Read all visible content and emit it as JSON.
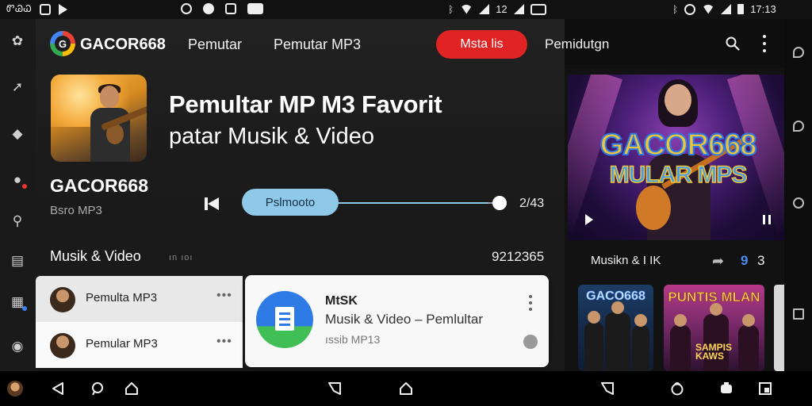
{
  "status_bar": {
    "left_text": "ᏛᏊᏇ",
    "right_time": "17:13",
    "mid_time": "12"
  },
  "header": {
    "brand": "GACOR668",
    "logo_letter": "G",
    "nav": [
      "Pemutar",
      "Pemutar MP3"
    ],
    "pill_label": "Msta lis",
    "nav_right": "Pemidutgn"
  },
  "now_playing": {
    "title": "Pemultar MP M3 Favorit",
    "subtitle": "patar Musik & Video",
    "artist": "GACOR668",
    "artist_sub": "Bsro MP3",
    "slider_label": "Pslmooto",
    "progress": 0.93,
    "time": "2/43"
  },
  "section": {
    "label": "Musik & Video",
    "sub": "ın ıoı",
    "count": "9212365"
  },
  "list": [
    {
      "label": "Pemulta MP3",
      "more": "•••"
    },
    {
      "label": "Pemular MP3",
      "more": "•••"
    }
  ],
  "card": {
    "title": "MtSK",
    "line": "Musik & Video – Pemlultar",
    "sub": "ıssib MP13"
  },
  "feature": {
    "line1": "GACOR668",
    "line2": "MULAR MPS",
    "caption": "Musikn & I IK",
    "num_blue": "9",
    "num": "3"
  },
  "thumbs": [
    {
      "title": "GACO668"
    },
    {
      "title": "PUNTIS MLAN",
      "sub": "SAMPIS\nKAWS"
    }
  ],
  "colors": {
    "accent_red": "#e02424",
    "slider_blue": "#8ec9ea",
    "number_blue": "#4a8ff0"
  }
}
